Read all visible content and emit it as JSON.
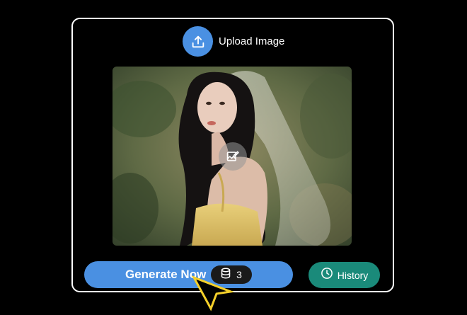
{
  "upload": {
    "label": "Upload Image",
    "icon": "upload-icon"
  },
  "image": {
    "alt": "Woman with long dark wavy hair wearing a sheer bridal veil and a yellow dress",
    "edit_icon": "edit-image-icon"
  },
  "generate": {
    "label": "Generate Now",
    "credits": "3",
    "credits_icon": "database-icon"
  },
  "history": {
    "label": "History",
    "icon": "clock-icon"
  },
  "colors": {
    "background": "#000000",
    "panel_border": "#ffffff",
    "primary_blue": "#4a90e2",
    "history_teal": "#1a8a7a",
    "credit_pill": "#1a1a1a",
    "cursor": "#f5d02a"
  }
}
